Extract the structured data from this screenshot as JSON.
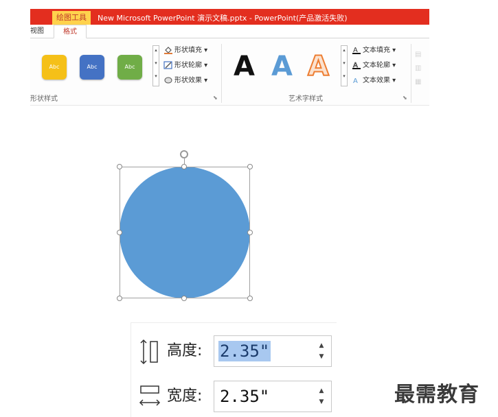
{
  "titlebar": {
    "context_tab": "绘图工具",
    "title": "New Microsoft PowerPoint 演示文稿.pptx - PowerPoint(产品激活失败)",
    "color": "#e32e1f"
  },
  "tabs": [
    {
      "label": "视图"
    },
    {
      "label": "格式",
      "active": true
    }
  ],
  "shape_styles": {
    "swatches": [
      {
        "label": "Abc",
        "color": "#f5c018"
      },
      {
        "label": "Abc",
        "color": "#4472c4"
      },
      {
        "label": "Abc",
        "color": "#70ad47"
      }
    ],
    "commands": [
      {
        "label": "形状填充",
        "icon": "fill-bucket-icon"
      },
      {
        "label": "形状轮廓",
        "icon": "pencil-outline-icon"
      },
      {
        "label": "形状效果",
        "icon": "effects-icon"
      }
    ],
    "group_label": "形状样式"
  },
  "wordart": {
    "samples": [
      {
        "label": "A",
        "color": "#111111"
      },
      {
        "label": "A",
        "color": "#5b9bd5"
      },
      {
        "label": "A",
        "color": "#ed7d31"
      }
    ],
    "commands": [
      {
        "label": "文本填充",
        "icon": "text-fill-icon"
      },
      {
        "label": "文本轮廓",
        "icon": "text-outline-icon"
      },
      {
        "label": "文本效果",
        "icon": "text-effects-icon"
      }
    ],
    "group_label": "艺术字样式"
  },
  "shape": {
    "type": "circle",
    "fill": "#5b9bd5"
  },
  "size": {
    "height_label": "高度:",
    "height_value": "2.35\"",
    "width_label": "宽度:",
    "width_value": "2.35\""
  },
  "watermark": "最需教育"
}
